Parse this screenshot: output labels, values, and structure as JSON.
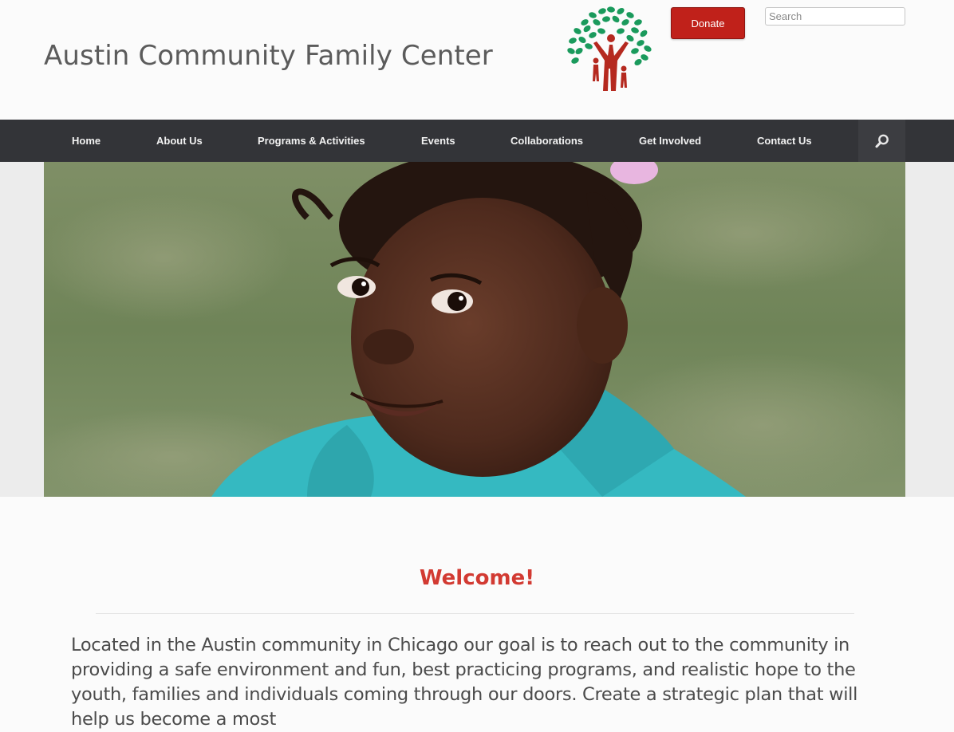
{
  "header": {
    "site_title": "Austin Community Family Center",
    "donate_label": "Donate",
    "search_placeholder": "Search"
  },
  "nav": {
    "items": [
      {
        "label": "Home"
      },
      {
        "label": "About Us"
      },
      {
        "label": "Programs & Activities"
      },
      {
        "label": "Events"
      },
      {
        "label": "Collaborations"
      },
      {
        "label": "Get Involved"
      },
      {
        "label": "Contact Us"
      }
    ],
    "search_icon": "search-icon"
  },
  "hero": {
    "image": "child-in-turquoise-shirt-photo"
  },
  "main": {
    "heading": "Welcome!",
    "intro": "Located in the Austin community in Chicago our goal is to reach out to the community in providing a safe environment and fun, best practicing programs, and realistic hope to the youth, families and individuals coming through our doors. Create a strategic plan that will help us become a most"
  },
  "colors": {
    "nav_bg": "#333438",
    "donate_red": "#c0211a",
    "welcome_red": "#d23a32",
    "logo_green": "#1a9a5c",
    "logo_red": "#b5291f"
  }
}
